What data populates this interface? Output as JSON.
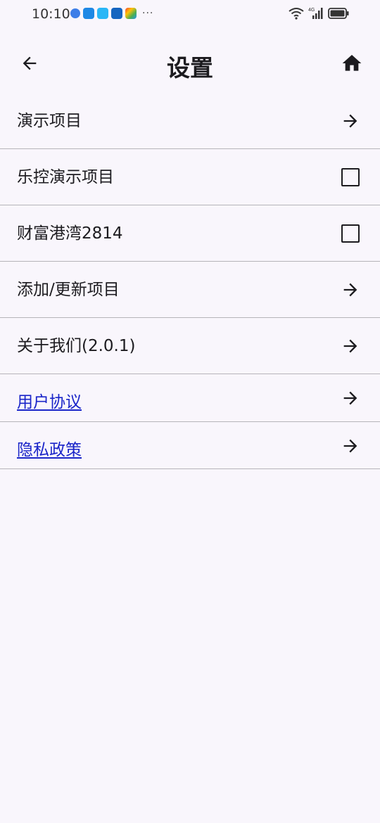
{
  "status_bar": {
    "time": "10:10",
    "more": "···",
    "network": "4G"
  },
  "header": {
    "title": "设置"
  },
  "settings": {
    "items": [
      {
        "label": "演示项目",
        "action": "arrow-right-icon",
        "link": false
      },
      {
        "label": "乐控演示项目",
        "action": "checkbox",
        "checked": false,
        "link": false
      },
      {
        "label": "财富港湾2814",
        "action": "checkbox",
        "checked": false,
        "link": false
      },
      {
        "label": "添加/更新项目",
        "action": "arrow-right-icon",
        "link": false
      },
      {
        "label": "关于我们(2.0.1)",
        "action": "arrow-right-icon",
        "link": false
      },
      {
        "label": "用户协议",
        "action": "arrow-right-icon",
        "link": true
      },
      {
        "label": "隐私政策",
        "action": "arrow-right-icon",
        "link": true
      }
    ]
  },
  "colors": {
    "background": "#f9f6fc",
    "text": "#1c1b1f",
    "link": "#1a25c9",
    "divider": "#b6b4b9"
  }
}
